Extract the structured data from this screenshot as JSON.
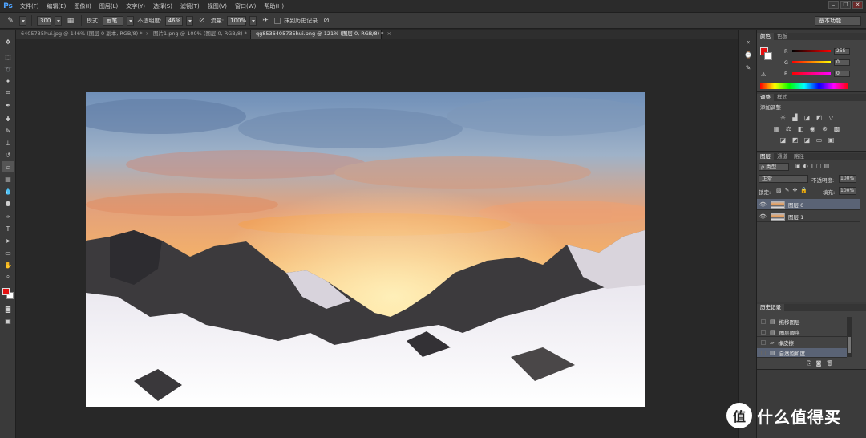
{
  "app": {
    "logo": "Ps",
    "accent": "#4ea3ff"
  },
  "menu": [
    "文件(F)",
    "编辑(E)",
    "图像(I)",
    "图层(L)",
    "文字(Y)",
    "选择(S)",
    "滤镜(T)",
    "视图(V)",
    "窗口(W)",
    "帮助(H)"
  ],
  "window_controls": [
    "–",
    "❐",
    "✕"
  ],
  "options": {
    "brush_size": "300",
    "mode_label": "模式:",
    "mode_value": "画笔",
    "opacity_label": "不透明度:",
    "opacity_value": "46%",
    "flow_label": "流量:",
    "flow_value": "100%",
    "history_label": "抹到历史记录",
    "workspace": "基本功能"
  },
  "tabs": [
    {
      "label": "6405735hui.jpg @ 146% (图层 0 副本, RGB/8) *",
      "active": false
    },
    {
      "label": "图片1.png @ 100% (图层 0, RGB/8) *",
      "active": false
    },
    {
      "label": "qg8536405735hui.png @ 121% (图层 0, RGB/8) *",
      "active": true
    }
  ],
  "color_panel": {
    "tabs": [
      "颜色",
      "色板"
    ],
    "r_label": "R",
    "g_label": "G",
    "b_label": "B",
    "r": "255",
    "g": "0",
    "b": "0",
    "foreground": "#e31010",
    "background": "#ffffff"
  },
  "adjustments_panel": {
    "tabs": [
      "调整",
      "样式"
    ],
    "heading": "添加调整",
    "icons": [
      "brightness-icon",
      "levels-icon",
      "curves-icon",
      "exposure-icon",
      "vibrance-icon",
      "hue-sat-icon",
      "color-balance-icon",
      "bw-icon",
      "photo-filter-icon",
      "channel-mixer-icon",
      "color-lookup-icon",
      "invert-icon",
      "posterize-icon",
      "threshold-icon",
      "gradient-map-icon",
      "selective-color-icon"
    ]
  },
  "layers_panel": {
    "tabs": [
      "图层",
      "通道",
      "路径"
    ],
    "filter": "ρ 类型",
    "blend_mode": "正常",
    "opacity_label": "不透明度:",
    "opacity": "100%",
    "lock_label": "锁定:",
    "fill_label": "填充:",
    "fill": "100%",
    "layers": [
      {
        "name": "图层 0",
        "active": true
      },
      {
        "name": "图层 1",
        "active": false
      }
    ]
  },
  "history_panel": {
    "title": "历史记录",
    "items": [
      {
        "name": "拖移图层",
        "active": false
      },
      {
        "name": "图层顺序",
        "active": false
      },
      {
        "name": "橡皮擦",
        "active": false
      },
      {
        "name": "自然饱和度",
        "active": true
      }
    ]
  },
  "watermark": {
    "symbol": "值",
    "text": "什么值得买"
  }
}
